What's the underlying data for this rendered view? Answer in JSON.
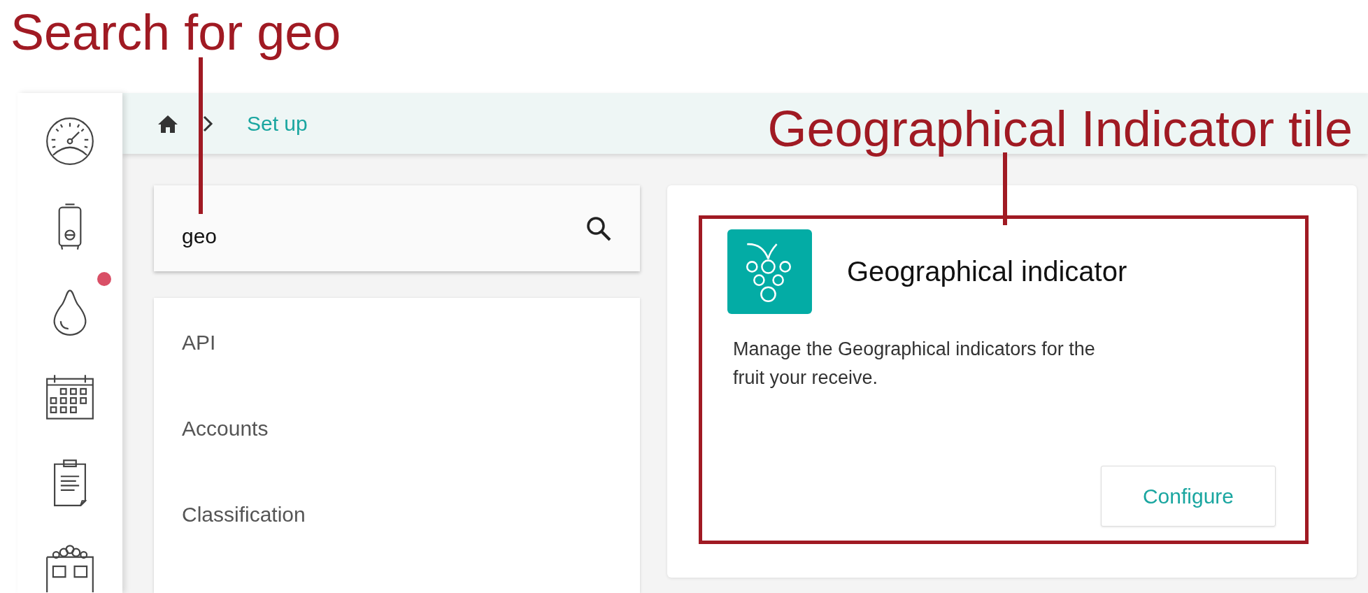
{
  "annotations": [
    {
      "text": "Search for geo",
      "kind": "search"
    },
    {
      "text": "Geographical Indicator tile",
      "kind": "tile"
    }
  ],
  "sidebar": {
    "items": [
      {
        "kind": "gauge"
      },
      {
        "kind": "tank"
      },
      {
        "kind": "drop",
        "notification": true
      },
      {
        "kind": "calendar"
      },
      {
        "kind": "clipboard"
      },
      {
        "kind": "bin"
      }
    ]
  },
  "breadcrumb": {
    "current": "Set up"
  },
  "search": {
    "value": "geo"
  },
  "menu": {
    "items": [
      "API",
      "Accounts",
      "Classification"
    ]
  },
  "tile": {
    "title": "Geographical indicator",
    "description": "Manage the Geographical indicators for the fruit your receive.",
    "button": "Configure"
  }
}
